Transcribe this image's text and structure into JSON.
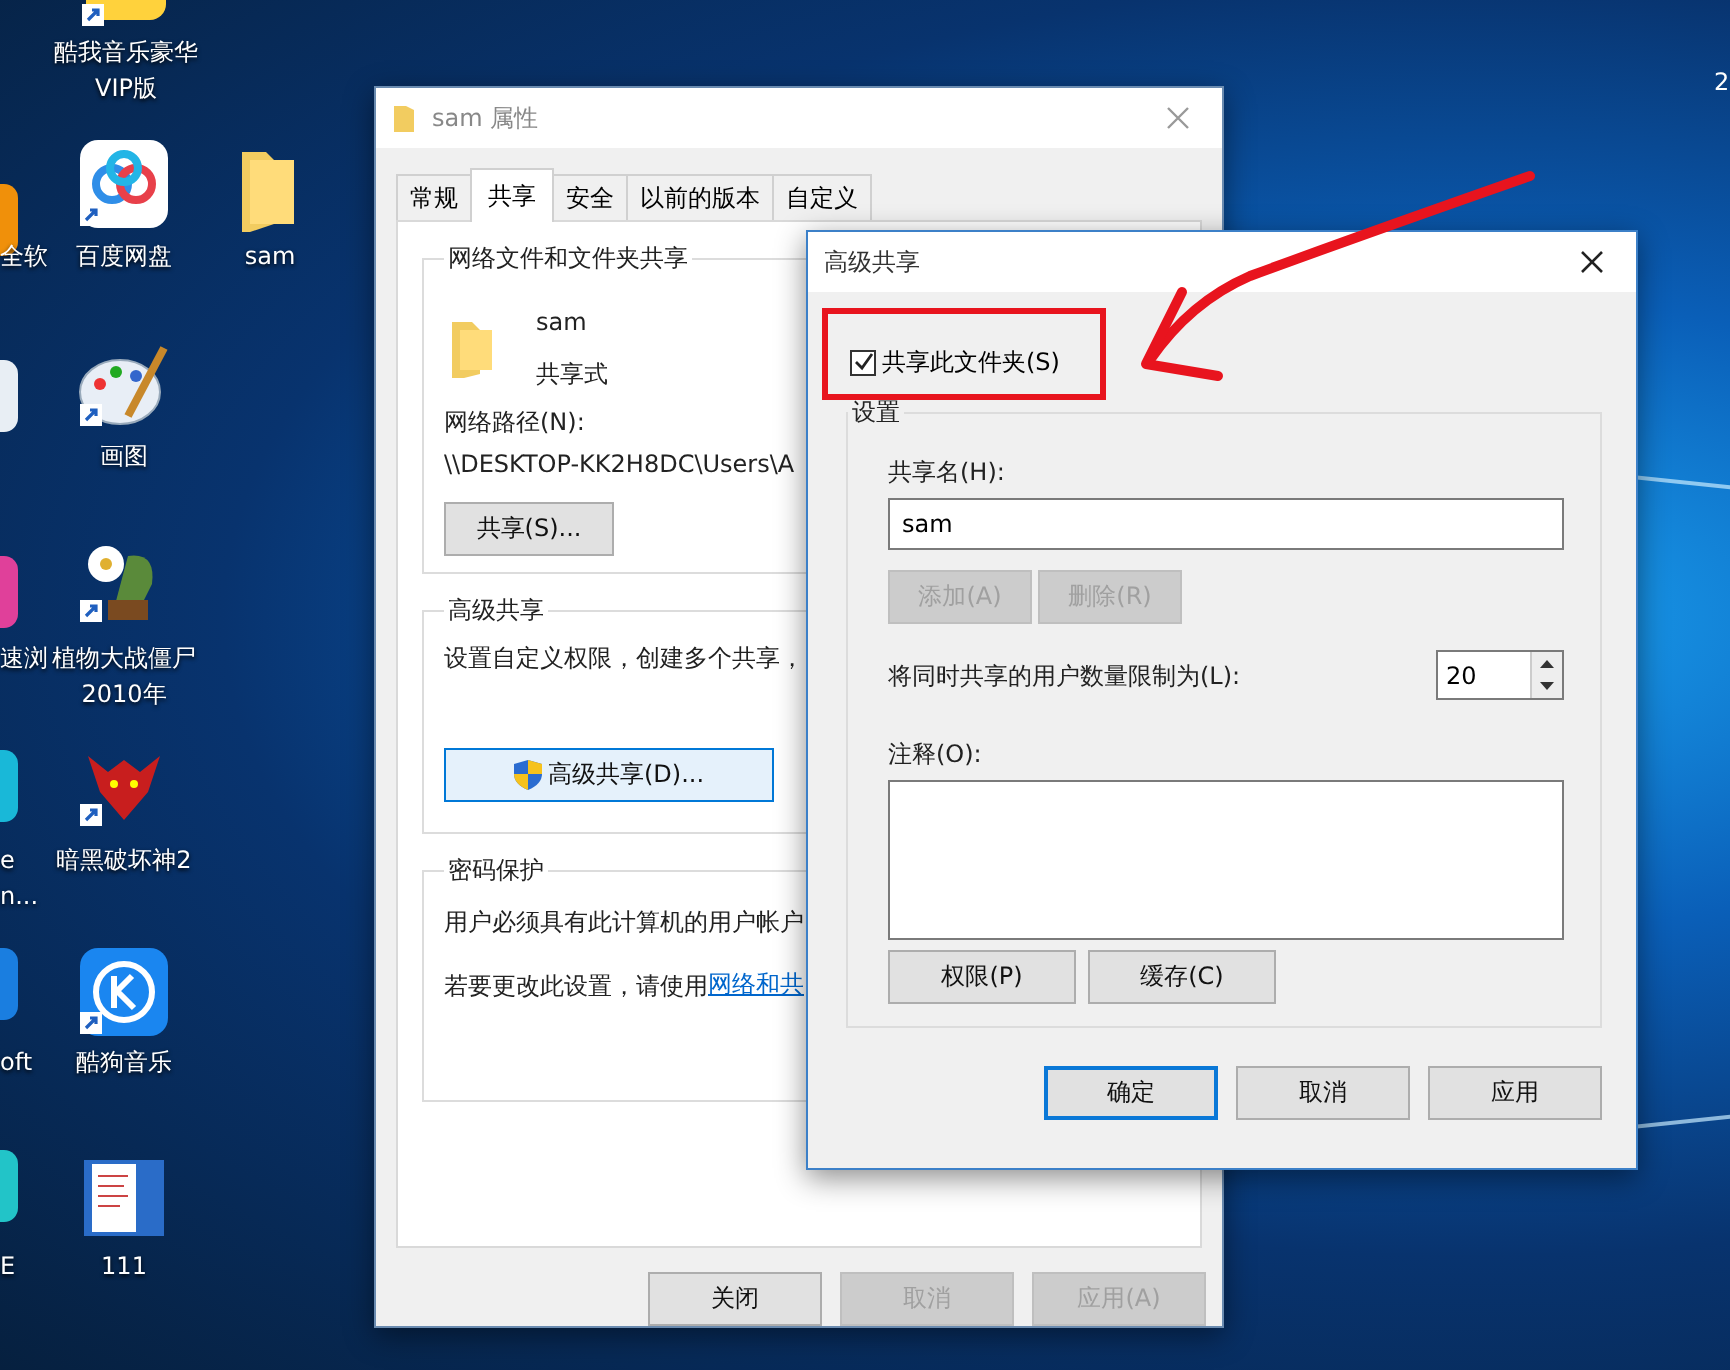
{
  "desktop": {
    "icons": [
      {
        "label": "酷我音乐豪华VIP版",
        "kind": "music-app"
      },
      {
        "label": "百度网盘",
        "kind": "cloud-app"
      },
      {
        "label": "sam",
        "kind": "folder"
      },
      {
        "label": "画图",
        "kind": "palette"
      },
      {
        "label": "植物大战僵尸2010年",
        "kind": "plant"
      },
      {
        "label": "暗黑破坏神2",
        "kind": "demon"
      },
      {
        "label": "酷狗音乐",
        "kind": "k-app"
      },
      {
        "label": "111",
        "kind": "document"
      }
    ],
    "edge_items": [
      {
        "lines": [
          "全软"
        ],
        "color": "#f0900a"
      },
      {
        "color": "#e8eef4"
      },
      {
        "lines": [
          "速浏"
        ],
        "color": "#e0409a"
      },
      {
        "lines": [
          "e",
          "n..."
        ],
        "color": "#19b8d8"
      },
      {
        "lines": [
          "oft"
        ],
        "color": "#1a7ee0"
      },
      {
        "lines": [
          "E"
        ],
        "color": "#22c4c8"
      }
    ],
    "corner_text": "2"
  },
  "properties_window": {
    "title": "sam 属性",
    "tabs": [
      {
        "label": "常规",
        "selected": false
      },
      {
        "label": "共享",
        "selected": true
      },
      {
        "label": "安全",
        "selected": false
      },
      {
        "label": "以前的版本",
        "selected": false
      },
      {
        "label": "自定义",
        "selected": false
      }
    ],
    "network_sharing": {
      "heading": "网络文件和文件夹共享",
      "folder_name": "sam",
      "status": "共享式",
      "path_label": "网络路径(N):",
      "path": "\\\\DESKTOP-KK2H8DC\\Users\\A",
      "share_button": "共享(S)..."
    },
    "advanced": {
      "heading": "高级共享",
      "description": "设置自定义权限，创建多个共享，",
      "button": {
        "label": "高级共享(D)...",
        "highlighted": true
      }
    },
    "password": {
      "heading": "密码保护",
      "description": "用户必须具有此计算机的用户帐户",
      "change_text": "若要更改此设置，请使用",
      "link": "网络和共"
    },
    "buttons": [
      {
        "label": "关闭",
        "disabled": false
      },
      {
        "label": "取消",
        "disabled": true
      },
      {
        "label": "应用(A)",
        "disabled": true
      }
    ]
  },
  "advanced_sharing_dialog": {
    "title": "高级共享",
    "share_checkbox": {
      "label": "共享此文件夹(S)",
      "checked": true
    },
    "settings": {
      "heading": "设置",
      "share_name_label": "共享名(H):",
      "share_name": "sam",
      "name_buttons": [
        {
          "label": "添加(A)",
          "disabled": true
        },
        {
          "label": "删除(R)",
          "disabled": true
        }
      ],
      "user_limit_label": "将同时共享的用户数量限制为(L):",
      "user_limit": "20",
      "comment_label": "注释(O):",
      "buttons": [
        {
          "label": "权限(P)",
          "disabled": false
        },
        {
          "label": "缓存(C)",
          "disabled": false
        }
      ]
    },
    "buttons": [
      {
        "label": "确定",
        "default": true
      },
      {
        "label": "取消",
        "default": false
      },
      {
        "label": "应用",
        "default": false
      }
    ]
  }
}
